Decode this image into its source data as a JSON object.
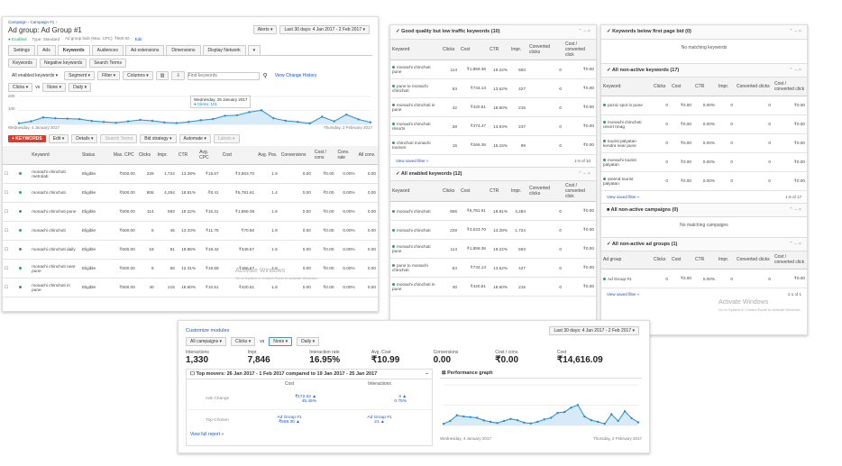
{
  "left": {
    "breadcrumb": "Campaign › Campaign #1 ›",
    "title": "Ad group: Ad Group #1",
    "meta": [
      "● Enabled",
      "Type: Standard",
      "Ad group bids (Max. CPC): ₹500.00",
      "Edit"
    ],
    "date_range": "Last 30 days: 4 Jan 2017 - 2 Feb 2017 ▾",
    "alerts": "Alerts ▾",
    "tabs": [
      "Settings",
      "Ads",
      "Keywords",
      "Audiences",
      "Ad extensions",
      "Dimensions",
      "Display Network",
      "▾"
    ],
    "subtabs": [
      "Keywords",
      "Negative keywords",
      "Search Terms"
    ],
    "filter_bar": {
      "keywords": "All enabled keywords ▾",
      "segment": "Segment ▾",
      "filter": "Filter ▾",
      "columns": "Columns ▾",
      "find_placeholder": "Find keywords",
      "history": "View Change History"
    },
    "chart_controls": {
      "metric1": "Clicks ▾",
      "vs": "vs",
      "metric2": "None ▾",
      "interval": "Daily ▾"
    },
    "chart_tooltip": {
      "date": "Wednesday, 25 January 2017",
      "value": "● Clicks: 101"
    },
    "chart_axis": {
      "y_top": "200",
      "y_mid": "100",
      "y_bottom": "0",
      "x_start": "Wednesday, 4 January 2017",
      "x_end": "Thursday, 2 February 2017"
    },
    "actions": {
      "add": "+ KEYWORDS",
      "edit": "Edit ▾",
      "details": "Details ▾",
      "search_terms": "Search Terms",
      "bid_strategy": "Bid strategy ▾",
      "automate": "Automate ▾",
      "labels": "Labels ▾"
    },
    "columns": [
      "",
      "",
      "Keyword",
      "Status",
      "Max. CPC",
      "Clicks",
      "Impr.",
      "CTR",
      "Avg. CPC",
      "Cost",
      "Avg. Pos.",
      "Conversions",
      "Cost / conv.",
      "Conv. rate",
      "All conv."
    ],
    "rows": [
      [
        "monachi chinchoti metrolab",
        "Eligible",
        "₹500.00",
        "228",
        "1,724",
        "13.28%",
        "₹15.67",
        "₹3,563.70",
        "1.9",
        "0.00",
        "₹0.00",
        "0.00%",
        "0.00"
      ],
      [
        "monachi chinchoti",
        "Eligible",
        "₹500.00",
        "806",
        "4,264",
        "18.81%",
        "₹8.41",
        "₹6,781.61",
        "1.4",
        "0.00",
        "₹0.00",
        "0.00%",
        "0.00"
      ],
      [
        "monachi chinchoti pune",
        "Eligible",
        "₹500.00",
        "114",
        "593",
        "19.22%",
        "₹16.31",
        "₹1,859.38",
        "1.6",
        "0.00",
        "₹0.00",
        "0.00%",
        "0.00"
      ],
      [
        "monachi chinchoti",
        "Eligible",
        "₹500.00",
        "6",
        "45",
        "13.33%",
        "₹11.75",
        "₹70.50",
        "1.9",
        "0.00",
        "₹0.00",
        "0.00%",
        "0.00"
      ],
      [
        "monachi chinchoti daily",
        "Eligible",
        "₹500.00",
        "18",
        "81",
        "19.85%",
        "₹19.42",
        "₹349.57",
        "1.6",
        "0.00",
        "₹0.00",
        "0.00%",
        "0.00"
      ],
      [
        "monachi chinchoti near pune",
        "Eligible",
        "₹500.00",
        "8",
        "65",
        "12.31%",
        "₹19.58",
        "₹156.67",
        "1.8",
        "0.00",
        "₹0.00",
        "0.00%",
        "0.00"
      ],
      [
        "monachi chinchoti in pune",
        "Eligible",
        "₹500.00",
        "40",
        "215",
        "18.60%",
        "₹10.51",
        "₹420.51",
        "1.8",
        "0.00",
        "₹0.00",
        "0.00%",
        "0.00"
      ]
    ],
    "activate": {
      "title": "Activate Windows",
      "sub": "Go to System in Control Panel to activate Windows."
    }
  },
  "mid": {
    "w1": {
      "title": "✓ Good quality but low traffic keywords (10)",
      "controls": "⌃ – ×",
      "columns": [
        "Keyword",
        "Clicks",
        "Cost",
        "CTR",
        "Impr.",
        "Converted clicks",
        "Cost / converted click"
      ],
      "rows": [
        [
          "monachi chinchoti pune",
          "114",
          "₹1,859.36",
          "19.22%",
          "593",
          "0",
          "₹0.00"
        ],
        [
          "pune to monachi chinchoti",
          "53",
          "₹734.13",
          "13.62%",
          "427",
          "0",
          "₹0.00"
        ],
        [
          "monachi chinchoti in pune",
          "42",
          "₹420.51",
          "18.60%",
          "215",
          "0",
          "₹0.00"
        ],
        [
          "monachi chinchoti resorts",
          "28",
          "₹374.47",
          "13.93%",
          "237",
          "0",
          "₹0.00"
        ],
        [
          "chinchoti monachi tourism",
          "15",
          "₹266.36",
          "15.15%",
          "99",
          "0",
          "₹0.00"
        ]
      ],
      "view_all": "View saved filter »",
      "pager": "1-5 of 10"
    },
    "w2": {
      "title": "✓ All enabled keywords (12)",
      "controls": "⌃ – ×",
      "columns": [
        "Keyword",
        "Clicks",
        "Cost",
        "CTR",
        "Impr.",
        "Converted clicks",
        "Cost / converted click"
      ],
      "rows": [
        [
          "monachi chinchoti",
          "806",
          "₹6,781.61",
          "18.81%",
          "4,284",
          "0",
          "₹0.00"
        ],
        [
          "monachi chinchoti",
          "229",
          "₹3,633.70",
          "13.28%",
          "1,724",
          "0",
          "₹0.00"
        ],
        [
          "monachi chinchoti pune",
          "114",
          "₹1,859.36",
          "19.22%",
          "593",
          "0",
          "₹0.00"
        ],
        [
          "pune to monachi chinchoti",
          "53",
          "₹734.13",
          "13.62%",
          "427",
          "0",
          "₹0.00"
        ],
        [
          "monachi chinchoti in pune",
          "40",
          "₹420.51",
          "18.60%",
          "215",
          "0",
          "₹0.00"
        ]
      ]
    }
  },
  "right": {
    "w1": {
      "title": "✓ Keywords below first page bid (0)",
      "controls": "⌃ – ×",
      "empty": "No matching keywords"
    },
    "w2": {
      "title": "✓ All non-active keywords (17)",
      "controls": "⌃ – ×",
      "columns": [
        "Keyword",
        "Clicks",
        "Cost",
        "CTR",
        "Impr.",
        "Converted clicks",
        "Cost / converted click"
      ],
      "rows": [
        [
          "picnic spot in pune",
          "0",
          "₹0.00",
          "0.00%",
          "0",
          "0",
          "₹0.00"
        ],
        [
          "monachi chinchoti resort treag",
          "0",
          "₹0.00",
          "0.00%",
          "0",
          "0",
          "₹0.00"
        ],
        [
          "tourist palyatan kendra near pune",
          "0",
          "₹0.00",
          "0.00%",
          "0",
          "0",
          "₹0.00"
        ],
        [
          "monachi tourist palyatan",
          "0",
          "₹0.00",
          "0.00%",
          "0",
          "0",
          "₹0.00"
        ],
        [
          "amend tourist palyatan",
          "0",
          "₹0.00",
          "0.00%",
          "0",
          "0",
          "₹0.00"
        ]
      ],
      "view_all": "View saved filter »",
      "pager": "1-5 of 17"
    },
    "w3": {
      "title": "■ All non-active campaigns (0)",
      "controls": "⌃ – ×",
      "empty": "No matching campaigns"
    },
    "w4": {
      "title": "✓ All non-active ad groups (1)",
      "controls": "⌃ – ×",
      "columns": [
        "Ad group",
        "Clicks",
        "Cost",
        "CTR",
        "Impr.",
        "Converted clicks",
        "Cost / converted click"
      ],
      "rows": [
        [
          "Ad Group #1",
          "0",
          "₹0.00",
          "0.00%",
          "0",
          "0",
          "₹0.00"
        ]
      ],
      "view_all": "View saved filter »",
      "pager": "1-1 of 1"
    },
    "activate": {
      "title": "Activate Windows",
      "sub": "Go to System in Control Panel to activate Windows."
    }
  },
  "bottom": {
    "customize": "Customize modules",
    "date_range": "Last 30 days: 4 Jan 2017 - 2 Feb 2017 ▾",
    "controls": {
      "campaigns": "All campaigns ▾",
      "metric1": "Clicks ▾",
      "vs": "vs",
      "metric2": "None ▾",
      "interval": "Daily ▾"
    },
    "stats": [
      {
        "label": "Interactions",
        "value": "1,330"
      },
      {
        "label": "Impr.",
        "value": "7,846"
      },
      {
        "label": "Interaction rate",
        "value": "16.95%"
      },
      {
        "label": "Avg. Cost",
        "value": "₹10.99"
      },
      {
        "label": "Conversions",
        "value": "0.00"
      },
      {
        "label": "Cost / conv.",
        "value": "₹0.00"
      },
      {
        "label": "Cost",
        "value": "₹14,616.09"
      }
    ],
    "movers": {
      "title": "☐ Top movers: 26 Jan 2017 - 1 Feb 2017 compared to 19 Jan 2017 - 25 Jan 2017",
      "cost": "Cost",
      "interactions": "Interactions",
      "row1_label": "Ads Change",
      "row2_label": "Top Chosen",
      "cost1": "₹172.02 ▲",
      "cost1b": "45.45%",
      "int1": "3 ▲",
      "int1b": "0.75%",
      "cost2": "₹568.30 ▲",
      "cost2_label": "Ad Group #1",
      "int2": "21 ▲",
      "int2_label": "Ad Group #1",
      "view_full": "View full report »"
    },
    "perf": {
      "title": "⊠ Performance graph",
      "x_start": "Wednesday, 4 January 2017",
      "x_end": "Thursday, 2 February 2017"
    }
  },
  "chart_data": [
    {
      "type": "area",
      "title": "",
      "series": [
        {
          "name": "Clicks",
          "values": [
            8,
            22,
            50,
            44,
            41,
            38,
            25,
            18,
            12,
            22,
            32,
            26,
            14,
            10,
            18,
            30,
            38,
            62,
            66,
            88,
            101,
            44,
            26,
            18,
            8,
            55,
            22,
            70,
            36,
            15
          ]
        }
      ],
      "ylim": [
        0,
        200
      ]
    },
    {
      "type": "area",
      "title": "",
      "series": [
        {
          "name": "Clicks",
          "values": [
            8,
            22,
            50,
            44,
            41,
            38,
            25,
            18,
            12,
            22,
            32,
            26,
            14,
            10,
            18,
            30,
            38,
            62,
            66,
            88,
            101,
            44,
            26,
            18,
            8,
            55,
            22,
            70,
            36,
            15
          ]
        }
      ],
      "ylim": [
        0,
        200
      ]
    }
  ]
}
